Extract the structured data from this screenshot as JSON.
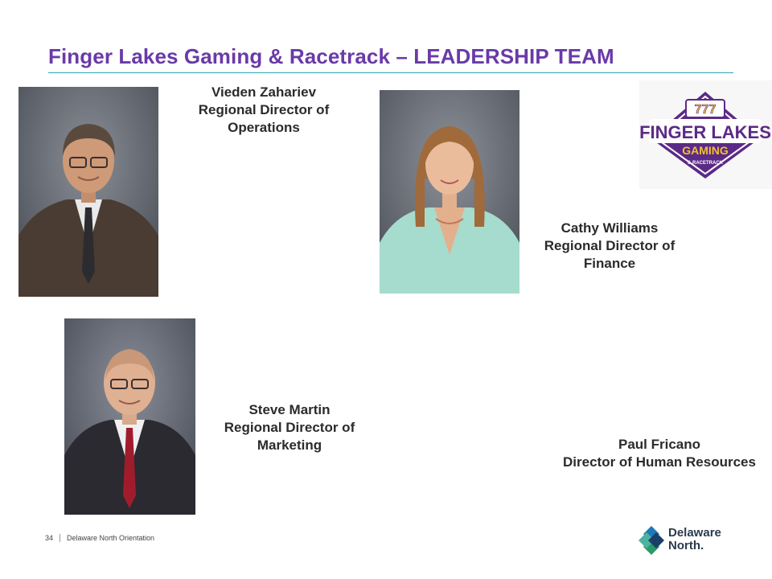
{
  "slide": {
    "title": "Finger Lakes Gaming & Racetrack – LEADERSHIP TEAM"
  },
  "leaders": [
    {
      "name": "Vieden Zahariev",
      "title_line1": "Regional Director of",
      "title_line2": "Operations"
    },
    {
      "name": "Cathy Williams",
      "title_line1": "Regional Director of",
      "title_line2": "Finance"
    },
    {
      "name": "Steve Martin",
      "title_line1": "Regional Director of",
      "title_line2": "Marketing"
    },
    {
      "name": "Paul Fricano",
      "title_line1": "Director of Human Resources"
    }
  ],
  "logo": {
    "lines": [
      "777",
      "FINGER LAKES",
      "GAMING",
      "& RACETRACK"
    ],
    "colors": {
      "purple": "#5b2a86",
      "gold": "#f2c12e"
    }
  },
  "footer": {
    "page_number": "34",
    "label": "Delaware North Orientation"
  },
  "brand": {
    "line1": "Delaware",
    "line2": "North."
  }
}
